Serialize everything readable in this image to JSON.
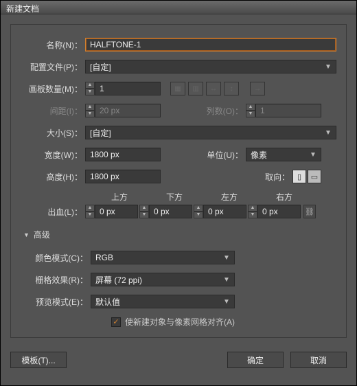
{
  "window": {
    "title": "新建文档"
  },
  "labels": {
    "name": "名称(N)：",
    "profile": "配置文件(P)：",
    "artboards": "画板数量(M)：",
    "spacing": "间距(I)：",
    "columns": "列数(O)：",
    "size": "大小(S)：",
    "width": "宽度(W)：",
    "height": "高度(H)：",
    "units": "单位(U)：",
    "orientation": "取向：",
    "bleed": "出血(L)：",
    "top": "上方",
    "bottom": "下方",
    "left": "左方",
    "right": "右方",
    "advanced": "高级",
    "colormode": "颜色模式(C)：",
    "raster": "栅格效果(R)：",
    "preview": "预览模式(E)：",
    "align_pixel": "使新建对象与像素网格对齐(A)"
  },
  "values": {
    "name": "HALFTONE-1",
    "profile": "[自定]",
    "artboards": "1",
    "spacing": "20 px",
    "columns": "1",
    "size": "[自定]",
    "width": "1800 px",
    "height": "1800 px",
    "units": "像素",
    "bleed_top": "0 px",
    "bleed_bottom": "0 px",
    "bleed_left": "0 px",
    "bleed_right": "0 px",
    "colormode": "RGB",
    "raster": "屏幕 (72 ppi)",
    "preview": "默认值"
  },
  "buttons": {
    "templates": "模板(T)...",
    "ok": "确定",
    "cancel": "取消"
  }
}
